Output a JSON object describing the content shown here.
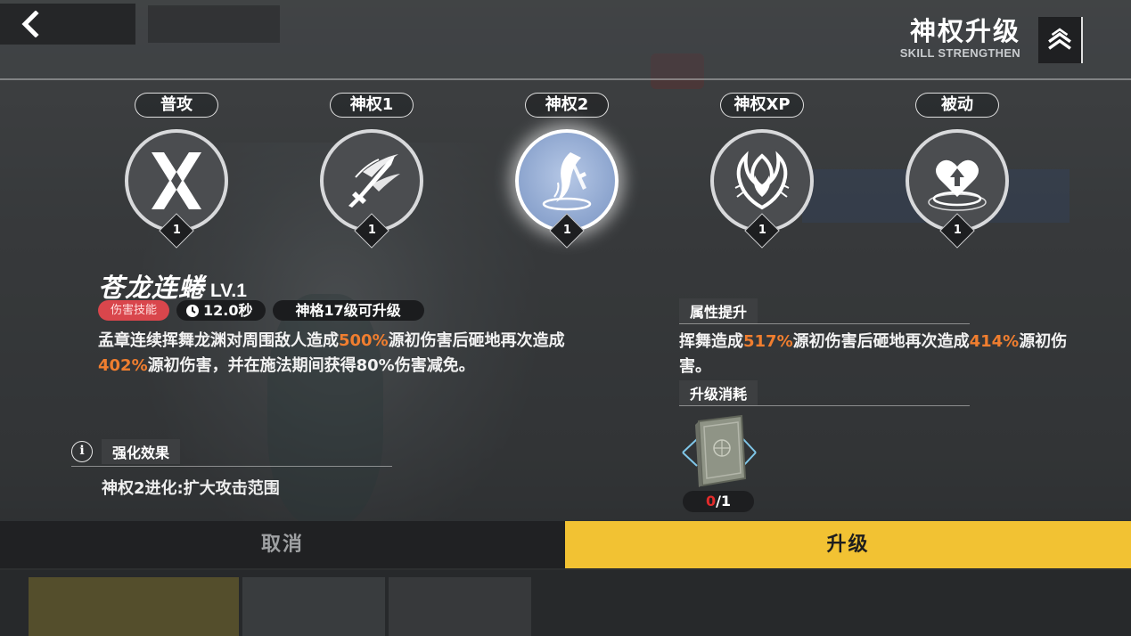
{
  "header": {
    "title": "神权升级",
    "subtitle": "SKILL STRENGTHEN"
  },
  "skills": [
    {
      "label": "普攻",
      "level": "1",
      "icon": "crossed-blades-icon"
    },
    {
      "label": "神权1",
      "level": "1",
      "icon": "sword-slash-icon"
    },
    {
      "label": "神权2",
      "level": "1",
      "icon": "dragon-sword-icon",
      "selected": true
    },
    {
      "label": "神权XP",
      "level": "1",
      "icon": "flame-burst-icon"
    },
    {
      "label": "被动",
      "level": "1",
      "icon": "heart-up-icon"
    }
  ],
  "detail": {
    "name": "苍龙连蜷",
    "level_text": "LV.1",
    "tag_type": "伤害技能",
    "cooldown": "12.0秒",
    "requirement": "神格17级可升级",
    "description_parts": [
      {
        "text": "孟章连续挥舞龙渊对周围敌人造成"
      },
      {
        "text": "500%",
        "highlight": true
      },
      {
        "text": "源初伤害后砸地再次造成"
      },
      {
        "text": "402%",
        "highlight": true
      },
      {
        "text": "源初伤害，并在施法期间获得80%伤害减免。"
      }
    ]
  },
  "enhance": {
    "header": "强化效果",
    "text": "神权2进化:扩大攻击范围"
  },
  "attribute": {
    "header": "属性提升",
    "parts": [
      {
        "text": "挥舞造成"
      },
      {
        "text": "517%",
        "highlight": true
      },
      {
        "text": "源初伤害后砸地再次造成"
      },
      {
        "text": "414%",
        "highlight": true
      },
      {
        "text": "源初伤害。"
      }
    ]
  },
  "cost": {
    "header": "升级消耗",
    "item_icon": "book-icon",
    "have": "0",
    "need": "/1"
  },
  "buttons": {
    "cancel": "取消",
    "upgrade": "升级"
  },
  "colors": {
    "highlight": "#f07e2f",
    "upgrade": "#f2c233",
    "damage_tag": "#d9464c",
    "selected_skill": "#8ea6cf"
  }
}
